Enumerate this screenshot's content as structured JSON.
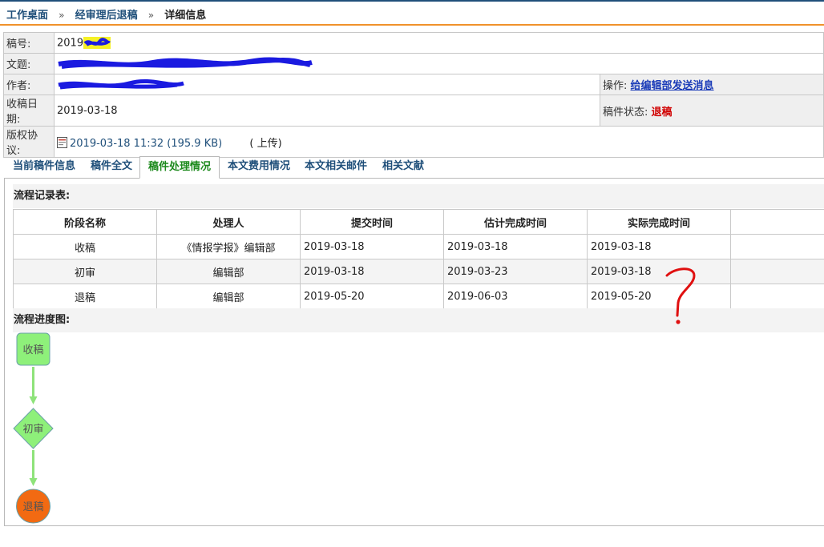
{
  "breadcrumb": {
    "items": [
      "工作桌面",
      "经审理后退稿"
    ],
    "separator": "»",
    "current": "详细信息"
  },
  "info": {
    "number_label": "稿号:",
    "number_value": "2019",
    "title_label": "文题:",
    "author_label": "作者:",
    "received_label": "收稿日期:",
    "received_value": "2019-03-18",
    "copyright_label": "版权协议:",
    "copyright_file": "2019-03-18 11:32 (195.9 KB)",
    "copyright_upload": "( 上传)",
    "action_label": "操作:",
    "action_link": "给编辑部发送消息",
    "status_label": "稿件状态:",
    "status_value": "退稿",
    "status_color": "#d00000"
  },
  "tabs": [
    {
      "label": "当前稿件信息"
    },
    {
      "label": "稿件全文"
    },
    {
      "label": "稿件处理情况",
      "active": true
    },
    {
      "label": "本文费用情况"
    },
    {
      "label": "本文相关邮件"
    },
    {
      "label": "相关文献"
    }
  ],
  "flow_records": {
    "title": "流程记录表:",
    "columns": [
      "阶段名称",
      "处理人",
      "提交时间",
      "估计完成时间",
      "实际完成时间"
    ],
    "rows": [
      {
        "stage": "收稿",
        "handler": "《情报学报》编辑部",
        "submitted": "2019-03-18",
        "estimated": "2019-03-18",
        "actual": "2019-03-18"
      },
      {
        "stage": "初审",
        "handler": "编辑部",
        "submitted": "2019-03-18",
        "estimated": "2019-03-23",
        "actual": "2019-03-18"
      },
      {
        "stage": "退稿",
        "handler": "编辑部",
        "submitted": "2019-05-20",
        "estimated": "2019-06-03",
        "actual": "2019-05-20"
      }
    ]
  },
  "flow_chart": {
    "title": "流程进度图:",
    "nodes": [
      {
        "label": "收稿",
        "shape": "rounded-rect",
        "color": "#8ef07a"
      },
      {
        "label": "初审",
        "shape": "diamond",
        "color": "#8ef07a"
      },
      {
        "label": "退稿",
        "shape": "circle",
        "color": "#f26a12"
      }
    ],
    "arrow_color": "#8ee37a"
  },
  "colors": {
    "brand_blue": "#1f4f7a",
    "accent_orange": "#f0922b",
    "active_tab_green": "#1d8a1d",
    "link_blue": "#1a3bb8"
  }
}
